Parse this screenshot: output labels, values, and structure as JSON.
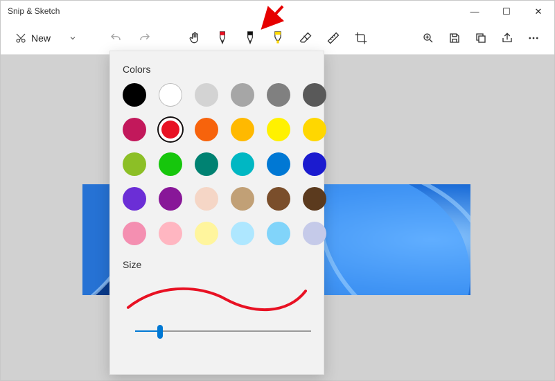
{
  "title": "Snip & Sketch",
  "window_controls": {
    "min": "—",
    "max": "☐",
    "close": "✕"
  },
  "toolbar": {
    "new_label": "New",
    "undo_tip": "Undo",
    "redo_tip": "Redo",
    "tools": [
      "touch-writing",
      "ballpoint-pen",
      "pencil",
      "highlighter",
      "eraser",
      "ruler",
      "crop"
    ],
    "active_tool_index": 1,
    "right": [
      "zoom",
      "save",
      "copy",
      "share",
      "more"
    ]
  },
  "popup": {
    "colors_label": "Colors",
    "size_label": "Size",
    "selected_index": 7,
    "colors": [
      "#000000",
      "#ffffff",
      "#d3d3d3",
      "#a6a6a6",
      "#808080",
      "#595959",
      "#c2185b",
      "#e81123",
      "#f7630c",
      "#ffb900",
      "#fff100",
      "#ffd700",
      "#8cbf26",
      "#16c60c",
      "#008272",
      "#00b7c3",
      "#0078d4",
      "#1b1bcf",
      "#6b2ed6",
      "#881798",
      "#f5d6c6",
      "#c1a076",
      "#7a4e2b",
      "#5b3a1e",
      "#f48fb1",
      "#ffb6c1",
      "#fff59d",
      "#aee7ff",
      "#81d4fa",
      "#c5cae9"
    ],
    "slider": {
      "value": 14,
      "max": 100
    }
  },
  "annotation": {
    "arrow_color": "#e60000"
  }
}
